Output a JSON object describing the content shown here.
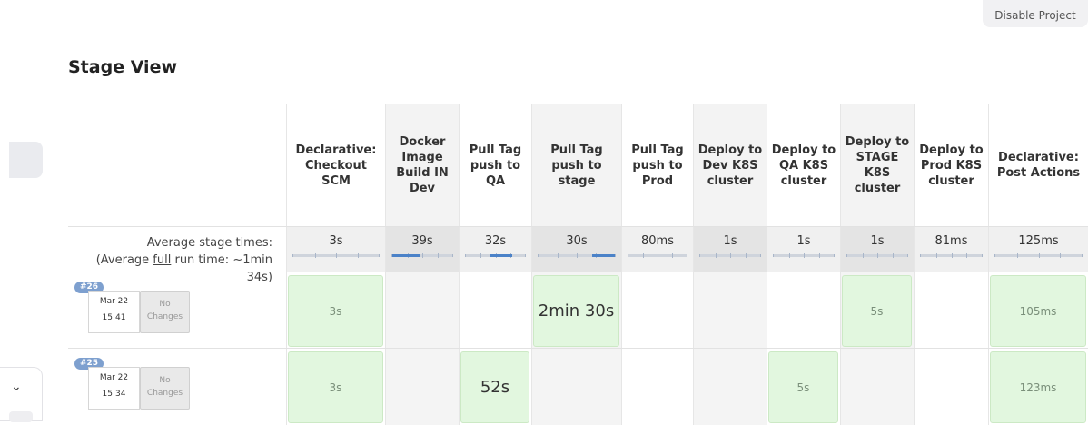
{
  "top_button": {
    "label": "Disable Project"
  },
  "page_title": "Stage View",
  "stages": [
    {
      "name": "Declarative: Checkout SCM",
      "avg": "3s",
      "fill_start": 0.0,
      "fill_end": 0.0
    },
    {
      "name": "Docker Image Build IN Dev",
      "avg": "39s",
      "fill_start": 0.0,
      "fill_end": 0.45
    },
    {
      "name": "Pull Tag push to QA",
      "avg": "32s",
      "fill_start": 0.42,
      "fill_end": 0.78
    },
    {
      "name": "Pull Tag push to stage",
      "avg": "30s",
      "fill_start": 0.7,
      "fill_end": 1.0
    },
    {
      "name": "Pull Tag push to Prod",
      "avg": "80ms",
      "fill_start": 0.0,
      "fill_end": 0.0
    },
    {
      "name": "Deploy to Dev K8S cluster",
      "avg": "1s",
      "fill_start": 0.0,
      "fill_end": 0.0
    },
    {
      "name": "Deploy to QA K8S cluster",
      "avg": "1s",
      "fill_start": 0.0,
      "fill_end": 0.0
    },
    {
      "name": "Deploy to STAGE K8S cluster",
      "avg": "1s",
      "fill_start": 0.0,
      "fill_end": 0.0
    },
    {
      "name": "Deploy to Prod K8S cluster",
      "avg": "81ms",
      "fill_start": 0.0,
      "fill_end": 0.0
    },
    {
      "name": "Declarative: Post Actions",
      "avg": "125ms",
      "fill_start": 0.0,
      "fill_end": 0.0
    }
  ],
  "avg_label": {
    "line1": "Average stage times:",
    "line2_prefix": "(Average ",
    "line2_link": "full",
    "line2_suffix": " run time: ~1min 34s)"
  },
  "builds": [
    {
      "number": "#26",
      "date": "Mar 22",
      "time": "15:41",
      "changes": "No Changes",
      "cells": [
        "3s",
        "",
        "",
        "2min 30s",
        "",
        "",
        "",
        "5s",
        "",
        "105ms"
      ]
    },
    {
      "number": "#25",
      "date": "Mar 22",
      "time": "15:34",
      "changes": "No Changes",
      "cells": [
        "3s",
        "",
        "52s",
        "",
        "",
        "",
        "5s",
        "",
        "",
        "123ms"
      ]
    }
  ]
}
